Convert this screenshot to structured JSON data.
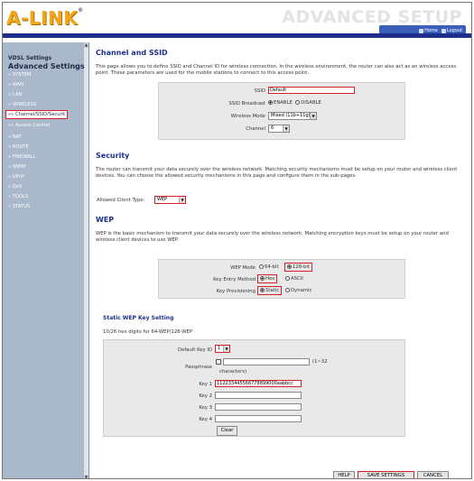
{
  "header": {
    "logo": "A-LINK",
    "logo_tm": "®",
    "title": "ADVANCED SETUP",
    "nav": [
      {
        "label": "Home",
        "icon": "home-icon"
      },
      {
        "label": "Logout",
        "icon": "logout-icon"
      }
    ]
  },
  "sidebar": {
    "vdsl": "VDSL Settings",
    "advanced": "Advanced Settings",
    "items": [
      {
        "label": "» SYSTEM"
      },
      {
        "label": "» WAN"
      },
      {
        "label": "» LAN"
      },
      {
        "label": "» WIRELESS"
      },
      {
        "label": "»» Channel/SSID/Securit"
      },
      {
        "label": "»» Access Control"
      },
      {
        "label": "» NAT"
      },
      {
        "label": "» ROUTE"
      },
      {
        "label": "» FIREWALL"
      },
      {
        "label": "» SNMP"
      },
      {
        "label": "» UPnP"
      },
      {
        "label": "» QoS"
      },
      {
        "label": "» TOOLS"
      },
      {
        "label": "» STATUS"
      }
    ]
  },
  "channel": {
    "title": "Channel and SSID",
    "desc": "This page allows you to define SSID and Channel ID for wireless connection. In the wireless environment, the router can also act as an wireless access point. These parameters are used for the mobile stations to connect to this access point.",
    "ssid_label": "SSID",
    "ssid_value": "Default",
    "broadcast_label": "SSID Broadcast",
    "broadcast_enable": "ENABLE",
    "broadcast_disable": "DISABLE",
    "mode_label": "Wireless Mode",
    "mode_value": "Mixed (11b+11g)",
    "channel_label": "Channel",
    "channel_value": "6"
  },
  "security": {
    "title": "Security",
    "desc": "The router can transmit your data securely over the wireless network. Matching security mechanisms must be setup on your router and wireless client devices. You can choose the allowed security mechanisms in this page and configure them in the sub-pages.",
    "client_type_label": "Allowed Client Type:",
    "client_type_value": "WEP"
  },
  "wep": {
    "title": "WEP",
    "desc": "WEP is the basic mechanism to transmit your data securely over the wireless network. Matching encryption keys must be setup on your router and wireless client devices to use WEP.",
    "mode_label": "WEP Mode",
    "mode_64": "64-bit",
    "mode_128": "128-bit",
    "entry_label": "Key Entry Method",
    "entry_hex": "Hex",
    "entry_ascii": "ASCII",
    "prov_label": "Key Provisioning",
    "prov_static": "Static",
    "prov_dynamic": "Dynamic"
  },
  "static_wep": {
    "title": "Static WEP Key Setting",
    "hint": "10/26 hex digits for 64-WEP/128-WEP",
    "default_key_label": "Default Key ID",
    "default_key_value": "1",
    "pass_label": "Passphrase",
    "pass_hint": "(1~32",
    "pass_hint2": "characters)",
    "key1_label": "Key 1",
    "key1_value": "112233445566778899000aabbcc",
    "key2_label": "Key 2",
    "key3_label": "Key 3",
    "key4_label": "Key 4",
    "clear_label": "Clear"
  },
  "footer": {
    "help": "HELP",
    "save": "SAVE SETTINGS",
    "cancel": "CANCEL"
  },
  "colors": {
    "accent_red": "#d4202a",
    "nav_blue": "#1d2f8a",
    "logo_orange": "#f2a71b",
    "sidebar_bg": "#aab8cc"
  }
}
